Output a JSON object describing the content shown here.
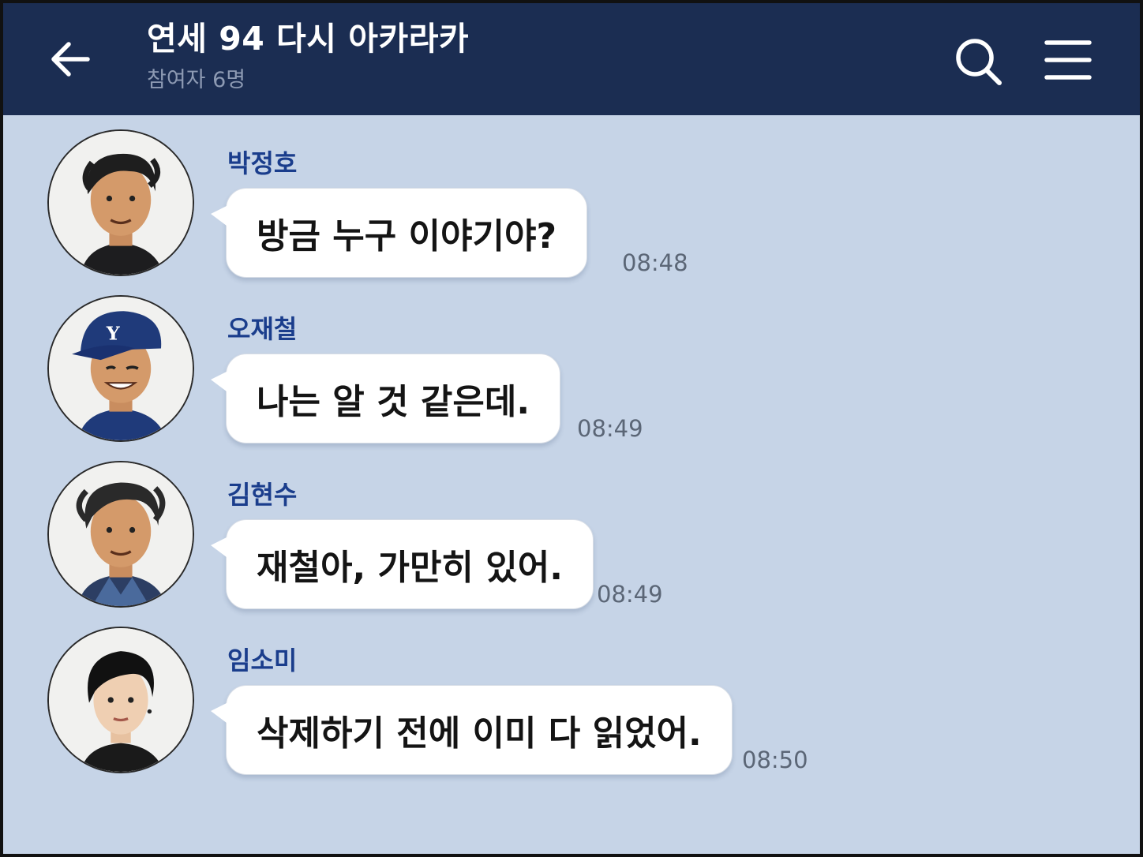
{
  "header": {
    "title": "연세 94 다시 아카라카",
    "subtitle": "참여자 6명",
    "back_icon": "arrow-left-icon",
    "search_icon": "search-icon",
    "menu_icon": "hamburger-menu-icon",
    "bg_color": "#1b2d52"
  },
  "chat": {
    "bg_color": "#c6d4e7",
    "sender_color": "#1a3d8c",
    "messages": [
      {
        "sender": "박정호",
        "text": "방금 누구 이야기야?",
        "time": "08:48"
      },
      {
        "sender": "오재철",
        "text": "나는 알 것 같은데.",
        "time": "08:49"
      },
      {
        "sender": "김현수",
        "text": "재철아, 가만히 있어.",
        "time": "08:49"
      },
      {
        "sender": "임소미",
        "text": "삭제하기 전에 이미 다 읽었어.",
        "time": "08:50"
      }
    ]
  }
}
